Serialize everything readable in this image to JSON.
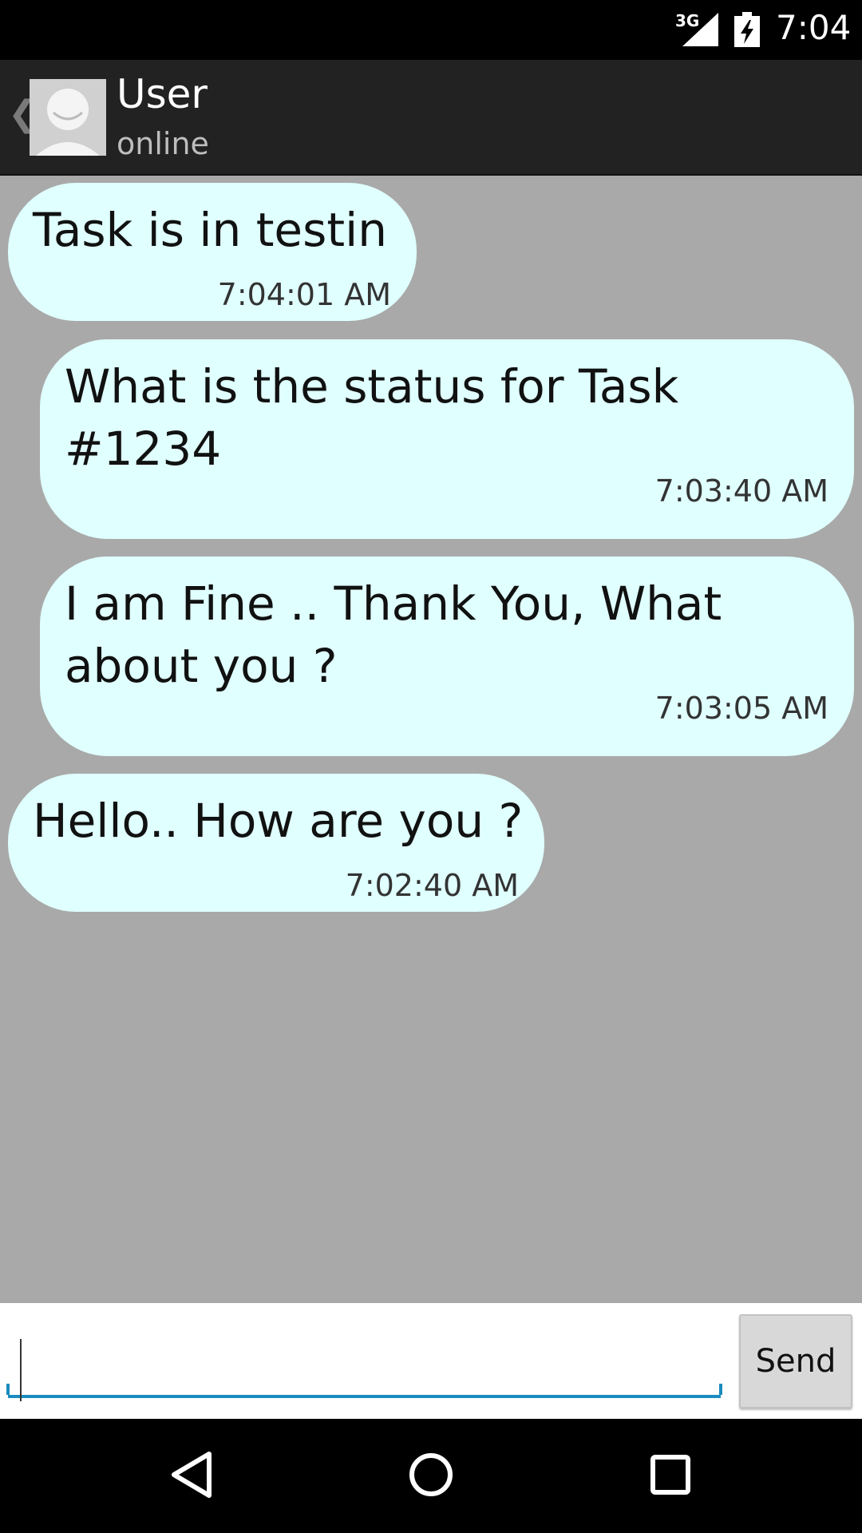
{
  "status_bar": {
    "network": "3G",
    "time": "7:04",
    "icons": [
      "signal-icon",
      "battery-charging-icon"
    ]
  },
  "header": {
    "name": "User",
    "status": "online",
    "icons": [
      "back-icon",
      "avatar-placeholder-icon"
    ]
  },
  "messages": [
    {
      "text": "Task is in testin",
      "time": "7:04:01 AM"
    },
    {
      "text": "What is the status for Task\n#1234",
      "time": "7:03:40 AM"
    },
    {
      "text": "I am Fine .. Thank You, What\nabout you ?",
      "time": "7:03:05 AM"
    },
    {
      "text": "Hello.. How are you ?",
      "time": "7:02:40 AM"
    }
  ],
  "composer": {
    "value": "",
    "placeholder": "",
    "send_label": "Send"
  },
  "colors": {
    "bubble": "#e0ffff",
    "chat_bg": "#a9a9a9",
    "accent": "#1a8cbf",
    "app_bar": "#222222"
  },
  "nav_bar": {
    "icons": [
      "back-triangle-icon",
      "home-circle-icon",
      "recents-square-icon"
    ]
  }
}
